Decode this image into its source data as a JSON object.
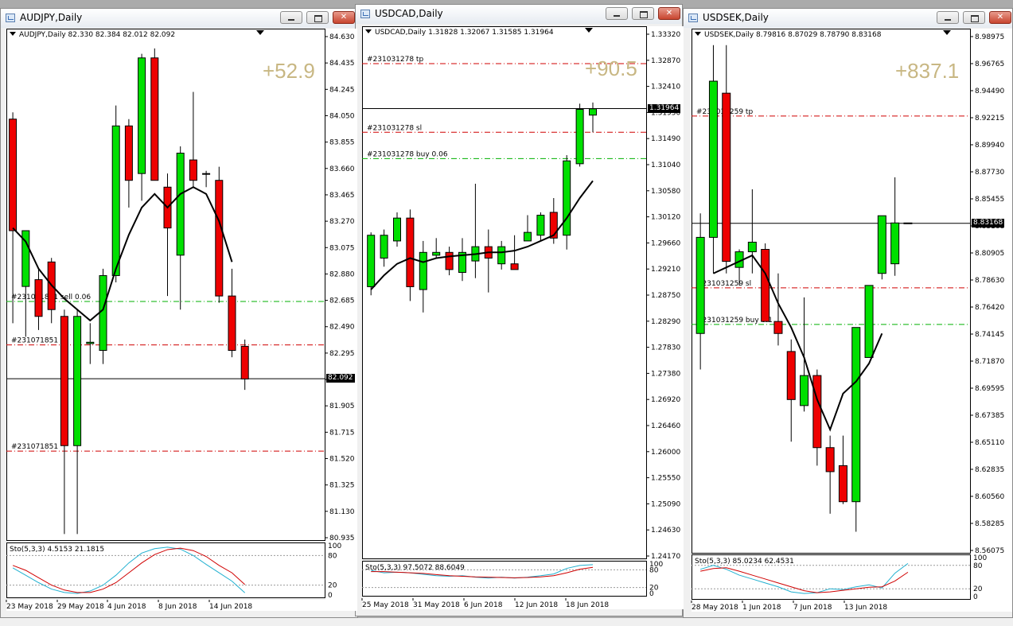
{
  "windows": [
    {
      "id": "audjpy",
      "title": "AUDJPY,Daily",
      "header": "AUDJPY,Daily  82.330 82.384 82.012 82.092",
      "profit": "+52.9",
      "current_price": "82.092",
      "price_ticks": [
        "84.630",
        "84.435",
        "84.245",
        "84.050",
        "83.855",
        "83.660",
        "83.465",
        "83.270",
        "83.075",
        "82.880",
        "82.685",
        "82.490",
        "82.295",
        "82.100",
        "81.905",
        "81.715",
        "81.520",
        "81.325",
        "81.130",
        "80.935"
      ],
      "date_ticks": [
        "23 May 2018",
        "29 May 2018",
        "4 Jun 2018",
        "8 Jun 2018",
        "14 Jun 2018"
      ],
      "order_labels": [
        "#231071851 sell 0.06",
        "#231071851",
        "#231071851"
      ],
      "stoch_header": "Sto(5,3,3) 4.5153 21.1815",
      "stoch_levels": [
        "100",
        "80",
        "20",
        "0"
      ]
    },
    {
      "id": "usdcad",
      "title": "USDCAD,Daily",
      "header": "USDCAD,Daily  1.31828 1.32067 1.31585 1.31964",
      "profit": "+90.5",
      "current_price": "1.31964",
      "price_ticks": [
        "1.33320",
        "1.32870",
        "1.32410",
        "1.31950",
        "1.31490",
        "1.31040",
        "1.30580",
        "1.30120",
        "1.29660",
        "1.29210",
        "1.28750",
        "1.28290",
        "1.27830",
        "1.27380",
        "1.26920",
        "1.26460",
        "1.26000",
        "1.25550",
        "1.25090",
        "1.24630",
        "1.24170"
      ],
      "date_ticks": [
        "25 May 2018",
        "31 May 2018",
        "6 Jun 2018",
        "12 Jun 2018",
        "18 Jun 2018"
      ],
      "order_labels": [
        "#231031278 tp",
        "#231031278 sl",
        "#231031278 buy 0.06"
      ],
      "stoch_header": "Sto(5,3,3) 97.5072 88.6049",
      "stoch_levels": [
        "100",
        "80",
        "20",
        "0"
      ]
    },
    {
      "id": "usdsek",
      "title": "USDSEK,Daily",
      "header": "USDSEK,Daily  8.79816 8.87029 8.78790 8.83168",
      "profit": "+837.1",
      "current_price": "8.83168",
      "price_ticks": [
        "8.98975",
        "8.96765",
        "8.94490",
        "8.92215",
        "8.89940",
        "8.87730",
        "8.85455",
        "8.83168",
        "8.80905",
        "8.78630",
        "8.76420",
        "8.74145",
        "8.71870",
        "8.69595",
        "8.67385",
        "8.65110",
        "8.62835",
        "8.60560",
        "8.58285",
        "8.56075"
      ],
      "date_ticks": [
        "28 May 2018",
        "1 Jun 2018",
        "7 Jun 2018",
        "13 Jun 2018"
      ],
      "order_labels": [
        "#231031259 tp",
        "#231031259 sl",
        "#231031259 buy 0.1"
      ],
      "stoch_header": "Sto(5,3,3) 85.0234 62.4531",
      "stoch_levels": [
        "100",
        "80",
        "20",
        "0"
      ]
    }
  ],
  "colors": {
    "bull": "#00e000",
    "bear": "#ee0000",
    "tp_sl": "#d00000",
    "entry": "#00b000",
    "ma": "#000000",
    "stoch_main": "#20b0d0",
    "stoch_signal": "#d00000",
    "profit": "#c8b783"
  },
  "chart_data": [
    {
      "type": "candlestick",
      "symbol": "AUDJPY",
      "timeframe": "Daily",
      "ylim": [
        80.935,
        84.63
      ],
      "current_price": 82.092,
      "x": [
        "2018-05-22",
        "2018-05-23",
        "2018-05-24",
        "2018-05-25",
        "2018-05-28",
        "2018-05-29",
        "2018-05-30",
        "2018-05-31",
        "2018-06-01",
        "2018-06-04",
        "2018-06-05",
        "2018-06-06",
        "2018-06-07",
        "2018-06-08",
        "2018-06-11",
        "2018-06-12",
        "2018-06-13",
        "2018-06-14",
        "2018-06-15"
      ],
      "ohlc": [
        [
          84.0,
          84.05,
          82.5,
          83.18
        ],
        [
          82.77,
          83.1,
          82.4,
          83.18
        ],
        [
          82.82,
          82.9,
          82.45,
          82.55
        ],
        [
          82.95,
          82.98,
          82.5,
          82.6
        ],
        [
          82.55,
          82.6,
          80.95,
          81.6
        ],
        [
          81.6,
          82.6,
          80.95,
          82.55
        ],
        [
          82.35,
          82.5,
          82.2,
          82.36
        ],
        [
          82.3,
          82.9,
          82.2,
          82.85
        ],
        [
          82.85,
          84.1,
          82.8,
          83.95
        ],
        [
          83.95,
          84.0,
          83.35,
          83.55
        ],
        [
          83.6,
          84.48,
          83.4,
          84.45
        ],
        [
          84.45,
          84.52,
          83.55,
          83.55
        ],
        [
          83.5,
          83.6,
          82.7,
          83.2
        ],
        [
          83.0,
          83.8,
          82.6,
          83.75
        ],
        [
          83.7,
          84.2,
          83.5,
          83.55
        ],
        [
          83.6,
          83.62,
          83.5,
          83.6
        ],
        [
          83.55,
          83.65,
          82.65,
          82.7
        ],
        [
          82.7,
          82.9,
          82.25,
          82.3
        ],
        [
          82.33,
          82.38,
          82.01,
          82.09
        ]
      ],
      "ma_period_label": "",
      "ma": [
        83.2,
        83.1,
        82.9,
        82.78,
        82.68,
        82.6,
        82.52,
        82.6,
        82.9,
        83.15,
        83.35,
        83.45,
        83.35,
        83.45,
        83.5,
        83.45,
        83.25,
        82.95,
        null
      ],
      "order_lines": [
        {
          "label": "#231071851 sell 0.06",
          "price": 82.66,
          "style": "entry"
        },
        {
          "label": "#231071851",
          "price": 82.34,
          "style": "sl"
        },
        {
          "label": "#231071851",
          "price": 81.56,
          "style": "tp"
        }
      ],
      "indicator": {
        "name": "Sto(5,3,3)",
        "main": [
          55,
          40,
          25,
          12,
          5,
          3,
          8,
          20,
          40,
          65,
          85,
          94,
          97,
          93,
          80,
          62,
          45,
          28,
          4.5
        ],
        "signal": [
          60,
          50,
          35,
          20,
          10,
          5,
          5,
          12,
          25,
          45,
          65,
          82,
          92,
          95,
          90,
          78,
          60,
          45,
          21.2
        ],
        "levels": [
          80,
          20
        ]
      }
    },
    {
      "type": "candlestick",
      "symbol": "USDCAD",
      "timeframe": "Daily",
      "ylim": [
        1.2417,
        1.3332
      ],
      "current_price": 1.31964,
      "x": [
        "2018-05-24",
        "2018-05-25",
        "2018-05-28",
        "2018-05-29",
        "2018-05-30",
        "2018-05-31",
        "2018-06-01",
        "2018-06-04",
        "2018-06-05",
        "2018-06-06",
        "2018-06-07",
        "2018-06-08",
        "2018-06-11",
        "2018-06-12",
        "2018-06-13",
        "2018-06-14",
        "2018-06-15",
        "2018-06-18"
      ],
      "ohlc": [
        [
          1.2885,
          1.298,
          1.287,
          1.2975
        ],
        [
          1.2935,
          1.2985,
          1.292,
          1.2975
        ],
        [
          1.2965,
          1.3015,
          1.2955,
          1.3005
        ],
        [
          1.3005,
          1.302,
          1.286,
          1.2885
        ],
        [
          1.288,
          1.2965,
          1.284,
          1.2945
        ],
        [
          1.294,
          1.297,
          1.2935,
          1.2945
        ],
        [
          1.2945,
          1.2955,
          1.2905,
          1.2915
        ],
        [
          1.291,
          1.297,
          1.2895,
          1.2945
        ],
        [
          1.293,
          1.3065,
          1.29,
          1.2955
        ],
        [
          1.2955,
          1.2985,
          1.2875,
          1.2935
        ],
        [
          1.2925,
          1.2965,
          1.2915,
          1.2955
        ],
        [
          1.2925,
          1.2975,
          1.2915,
          1.2915
        ],
        [
          1.2965,
          1.301,
          1.2965,
          1.298
        ],
        [
          1.2975,
          1.3015,
          1.2965,
          1.301
        ],
        [
          1.3015,
          1.304,
          1.296,
          1.297
        ],
        [
          1.2975,
          1.3115,
          1.295,
          1.3105
        ],
        [
          1.31,
          1.3205,
          1.3095,
          1.3195
        ],
        [
          1.3185,
          1.3207,
          1.3155,
          1.3196
        ]
      ],
      "ma_period_label": "",
      "ma": [
        1.288,
        1.2905,
        1.2925,
        1.2935,
        1.2928,
        1.2935,
        1.2938,
        1.294,
        1.2942,
        1.2945,
        1.2945,
        1.2948,
        1.2955,
        1.2965,
        1.2975,
        1.3005,
        1.304,
        1.307
      ],
      "order_lines": [
        {
          "label": "#231031278 tp",
          "price": 1.3275,
          "style": "tp"
        },
        {
          "label": "#231031278 sl",
          "price": 1.3155,
          "style": "sl"
        },
        {
          "label": "#231031278 buy 0.06",
          "price": 1.3109,
          "style": "entry"
        }
      ],
      "indicator": {
        "name": "Sto(5,3,3)",
        "main": [
          78,
          70,
          72,
          70,
          65,
          60,
          58,
          60,
          55,
          52,
          55,
          52,
          55,
          60,
          66,
          85,
          95,
          97.5
        ],
        "signal": [
          74,
          74,
          72,
          70,
          68,
          64,
          60,
          58,
          56,
          55,
          54,
          53,
          54,
          56,
          60,
          70,
          82,
          88.6
        ],
        "levels": [
          80,
          20
        ]
      }
    },
    {
      "type": "candlestick",
      "symbol": "USDSEK",
      "timeframe": "Daily",
      "ylim": [
        8.56075,
        8.98975
      ],
      "current_price": 8.83168,
      "x": [
        "2018-05-25",
        "2018-05-28",
        "2018-05-29",
        "2018-05-30",
        "2018-05-31",
        "2018-06-01",
        "2018-06-04",
        "2018-06-05",
        "2018-06-06",
        "2018-06-07",
        "2018-06-08",
        "2018-06-11",
        "2018-06-12",
        "2018-06-13",
        "2018-06-14",
        "2018-06-15",
        "2018-06-18"
      ],
      "ohlc": [
        [
          8.74,
          8.84,
          8.71,
          8.82
        ],
        [
          8.82,
          8.98,
          8.79,
          8.95
        ],
        [
          8.94,
          8.98,
          8.79,
          8.8
        ],
        [
          8.795,
          8.81,
          8.78,
          8.808
        ],
        [
          8.808,
          8.86,
          8.79,
          8.816
        ],
        [
          8.81,
          8.815,
          8.75,
          8.75
        ],
        [
          8.75,
          8.79,
          8.73,
          8.74
        ],
        [
          8.725,
          8.735,
          8.65,
          8.685
        ],
        [
          8.68,
          8.77,
          8.675,
          8.705
        ],
        [
          8.705,
          8.71,
          8.63,
          8.645
        ],
        [
          8.645,
          8.655,
          8.59,
          8.625
        ],
        [
          8.63,
          8.655,
          8.598,
          8.6
        ],
        [
          8.6,
          8.745,
          8.575,
          8.745
        ],
        [
          8.72,
          8.78,
          8.72,
          8.78
        ],
        [
          8.79,
          8.838,
          8.785,
          8.838
        ],
        [
          8.798,
          8.87,
          8.788,
          8.832
        ],
        [
          8.832,
          8.832,
          8.832,
          8.832
        ]
      ],
      "ma_period_label": "",
      "ma": [
        null,
        8.79,
        8.795,
        8.8,
        8.805,
        8.79,
        8.765,
        8.745,
        8.72,
        8.685,
        8.66,
        8.69,
        8.7,
        8.715,
        8.74,
        null,
        null
      ],
      "order_lines": [
        {
          "label": "#231031259 tp",
          "price": 8.921,
          "style": "tp"
        },
        {
          "label": "#231031259 sl",
          "price": 8.778,
          "style": "sl"
        },
        {
          "label": "#231031259 buy 0.1",
          "price": 8.7475,
          "style": "entry"
        }
      ],
      "indicator": {
        "name": "Sto(5,3,3)",
        "main": [
          70,
          80,
          70,
          55,
          45,
          35,
          25,
          12,
          8,
          10,
          20,
          18,
          25,
          30,
          22,
          60,
          85
        ],
        "signal": [
          65,
          72,
          74,
          65,
          55,
          45,
          35,
          25,
          15,
          10,
          12,
          16,
          20,
          24,
          25,
          40,
          62.5
        ],
        "levels": [
          80,
          20
        ]
      }
    }
  ]
}
